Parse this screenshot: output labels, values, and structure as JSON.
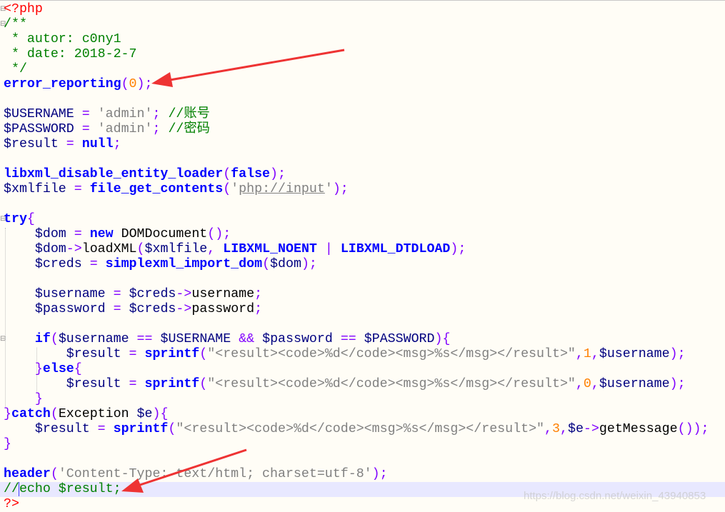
{
  "editor": {
    "language": "php",
    "current_line": 33,
    "colors": {
      "tag": "#ff0000",
      "comment": "#008000",
      "keyword": "#0000ff",
      "operator": "#8000ff",
      "number": "#ff8000",
      "string": "#808080",
      "variable": "#000080",
      "current_line_bg": "#e8e8ff",
      "background": "#fffdf6",
      "arrow": "#ee3333"
    },
    "lines": [
      [
        [
          "tag",
          "<?php"
        ]
      ],
      [
        [
          "cm",
          "/**"
        ]
      ],
      [
        [
          "cm",
          " * autor: c0ny1"
        ]
      ],
      [
        [
          "cm",
          " * date: 2018-2-7"
        ]
      ],
      [
        [
          "cm",
          " */"
        ]
      ],
      [
        [
          "kw",
          "error_reporting"
        ],
        [
          "op",
          "("
        ],
        [
          "num",
          "0"
        ],
        [
          "op",
          ");"
        ]
      ],
      [],
      [
        [
          "var",
          "$USERNAME"
        ],
        [
          "op",
          " = "
        ],
        [
          "str",
          "'admin'"
        ],
        [
          "op",
          ";"
        ],
        [
          "id",
          " "
        ],
        [
          "cm",
          "//账号"
        ]
      ],
      [
        [
          "var",
          "$PASSWORD"
        ],
        [
          "op",
          " = "
        ],
        [
          "str",
          "'admin'"
        ],
        [
          "op",
          ";"
        ],
        [
          "id",
          " "
        ],
        [
          "cm",
          "//密码"
        ]
      ],
      [
        [
          "var",
          "$result"
        ],
        [
          "op",
          " = "
        ],
        [
          "kw",
          "null"
        ],
        [
          "op",
          ";"
        ]
      ],
      [],
      [
        [
          "kw",
          "libxml_disable_entity_loader"
        ],
        [
          "op",
          "("
        ],
        [
          "kw",
          "false"
        ],
        [
          "op",
          ");"
        ]
      ],
      [
        [
          "var",
          "$xmlfile"
        ],
        [
          "op",
          " = "
        ],
        [
          "kw",
          "file_get_contents"
        ],
        [
          "op",
          "("
        ],
        [
          "str",
          "'"
        ],
        [
          "url",
          "php://input"
        ],
        [
          "str",
          "'"
        ],
        [
          "op",
          ");"
        ]
      ],
      [],
      [
        [
          "kw",
          "try"
        ],
        [
          "op",
          "{"
        ]
      ],
      [
        [
          "id",
          "    "
        ],
        [
          "var",
          "$dom"
        ],
        [
          "op",
          " = "
        ],
        [
          "kw",
          "new"
        ],
        [
          "id",
          " DOMDocument"
        ],
        [
          "op",
          "();"
        ]
      ],
      [
        [
          "id",
          "    "
        ],
        [
          "var",
          "$dom"
        ],
        [
          "op",
          "->"
        ],
        [
          "id",
          "loadXML"
        ],
        [
          "op",
          "("
        ],
        [
          "var",
          "$xmlfile"
        ],
        [
          "op",
          ", "
        ],
        [
          "kw",
          "LIBXML_NOENT"
        ],
        [
          "op",
          " | "
        ],
        [
          "kw",
          "LIBXML_DTDLOAD"
        ],
        [
          "op",
          ");"
        ]
      ],
      [
        [
          "id",
          "    "
        ],
        [
          "var",
          "$creds"
        ],
        [
          "op",
          " = "
        ],
        [
          "kw",
          "simplexml_import_dom"
        ],
        [
          "op",
          "("
        ],
        [
          "var",
          "$dom"
        ],
        [
          "op",
          ");"
        ]
      ],
      [],
      [
        [
          "id",
          "    "
        ],
        [
          "var",
          "$username"
        ],
        [
          "op",
          " = "
        ],
        [
          "var",
          "$creds"
        ],
        [
          "op",
          "->"
        ],
        [
          "id",
          "username"
        ],
        [
          "op",
          ";"
        ]
      ],
      [
        [
          "id",
          "    "
        ],
        [
          "var",
          "$password"
        ],
        [
          "op",
          " = "
        ],
        [
          "var",
          "$creds"
        ],
        [
          "op",
          "->"
        ],
        [
          "id",
          "password"
        ],
        [
          "op",
          ";"
        ]
      ],
      [],
      [
        [
          "id",
          "    "
        ],
        [
          "kw",
          "if"
        ],
        [
          "op",
          "("
        ],
        [
          "var",
          "$username"
        ],
        [
          "op",
          " == "
        ],
        [
          "var",
          "$USERNAME"
        ],
        [
          "op",
          " && "
        ],
        [
          "var",
          "$password"
        ],
        [
          "op",
          " == "
        ],
        [
          "var",
          "$PASSWORD"
        ],
        [
          "op",
          "){"
        ]
      ],
      [
        [
          "id",
          "        "
        ],
        [
          "var",
          "$result"
        ],
        [
          "op",
          " = "
        ],
        [
          "kw",
          "sprintf"
        ],
        [
          "op",
          "("
        ],
        [
          "str",
          "\"<result><code>%d</code><msg>%s</msg></result>\""
        ],
        [
          "op",
          ","
        ],
        [
          "num",
          "1"
        ],
        [
          "op",
          ","
        ],
        [
          "var",
          "$username"
        ],
        [
          "op",
          ");"
        ]
      ],
      [
        [
          "id",
          "    "
        ],
        [
          "op",
          "}"
        ],
        [
          "kw",
          "else"
        ],
        [
          "op",
          "{"
        ]
      ],
      [
        [
          "id",
          "        "
        ],
        [
          "var",
          "$result"
        ],
        [
          "op",
          " = "
        ],
        [
          "kw",
          "sprintf"
        ],
        [
          "op",
          "("
        ],
        [
          "str",
          "\"<result><code>%d</code><msg>%s</msg></result>\""
        ],
        [
          "op",
          ","
        ],
        [
          "num",
          "0"
        ],
        [
          "op",
          ","
        ],
        [
          "var",
          "$username"
        ],
        [
          "op",
          ");"
        ]
      ],
      [
        [
          "id",
          "    "
        ],
        [
          "op",
          "}"
        ]
      ],
      [
        [
          "op",
          "}"
        ],
        [
          "kw",
          "catch"
        ],
        [
          "op",
          "("
        ],
        [
          "id",
          "Exception "
        ],
        [
          "var",
          "$e"
        ],
        [
          "op",
          "){"
        ]
      ],
      [
        [
          "id",
          "    "
        ],
        [
          "var",
          "$result"
        ],
        [
          "op",
          " = "
        ],
        [
          "kw",
          "sprintf"
        ],
        [
          "op",
          "("
        ],
        [
          "str",
          "\"<result><code>%d</code><msg>%s</msg></result>\""
        ],
        [
          "op",
          ","
        ],
        [
          "num",
          "3"
        ],
        [
          "op",
          ","
        ],
        [
          "var",
          "$e"
        ],
        [
          "op",
          "->"
        ],
        [
          "id",
          "getMessage"
        ],
        [
          "op",
          "());"
        ]
      ],
      [
        [
          "op",
          "}"
        ]
      ],
      [],
      [
        [
          "kw",
          "header"
        ],
        [
          "op",
          "("
        ],
        [
          "str",
          "'Content-Type: text/html; charset=utf-8'"
        ],
        [
          "op",
          ");"
        ]
      ],
      [
        [
          "cm",
          "//echo $result;"
        ]
      ],
      [
        [
          "tag",
          "?>"
        ]
      ]
    ]
  },
  "watermark": "https://blog.csdn.net/weixin_43940853"
}
